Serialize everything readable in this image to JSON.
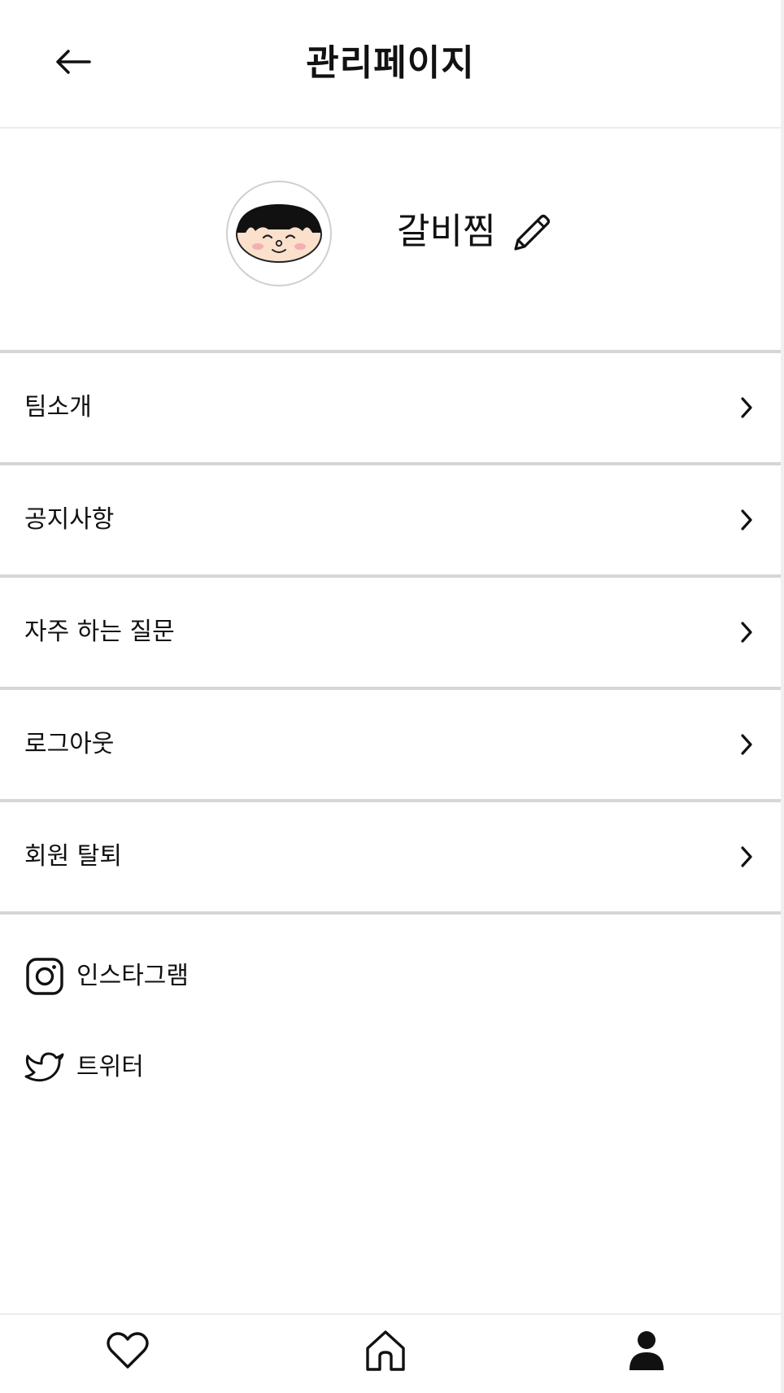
{
  "header": {
    "title": "관리페이지",
    "back_icon": "arrow-left-icon"
  },
  "profile": {
    "nickname": "갈비찜",
    "avatar_icon": "cartoon-face-avatar",
    "edit_icon": "pencil-icon"
  },
  "menu": {
    "items": [
      {
        "label": "팀소개",
        "icon": "chevron-right-icon"
      },
      {
        "label": "공지사항",
        "icon": "chevron-right-icon"
      },
      {
        "label": "자주 하는 질문",
        "icon": "chevron-right-icon"
      },
      {
        "label": "로그아웃",
        "icon": "chevron-right-icon"
      },
      {
        "label": "회원 탈퇴",
        "icon": "chevron-right-icon"
      }
    ]
  },
  "social": {
    "instagram": {
      "label": "인스타그램",
      "icon": "instagram-icon"
    },
    "twitter": {
      "label": "트위터",
      "icon": "twitter-icon"
    }
  },
  "bottom_nav": {
    "items": [
      {
        "icon": "heart-icon"
      },
      {
        "icon": "home-icon"
      },
      {
        "icon": "person-icon",
        "active": true
      }
    ]
  },
  "colors": {
    "text": "#111111",
    "divider": "#d6d6d6",
    "background": "#ffffff"
  }
}
